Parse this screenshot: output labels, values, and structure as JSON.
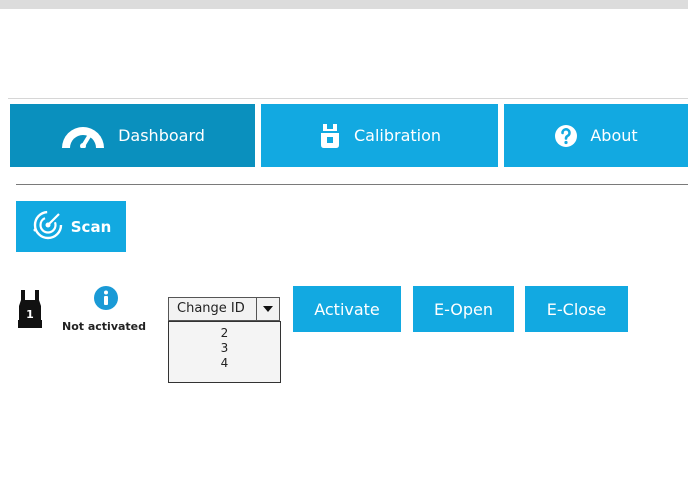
{
  "tabs": [
    {
      "label": "Dashboard",
      "icon": "dashboard-gauge-icon",
      "active": true
    },
    {
      "label": "Calibration",
      "icon": "gripper-calibration-icon",
      "active": false
    },
    {
      "label": "About",
      "icon": "question-icon",
      "active": false
    }
  ],
  "scan": {
    "label": "Scan",
    "icon": "radar-scan-icon"
  },
  "gripper": {
    "icon": "gripper-1-icon",
    "status_icon": "info-icon",
    "status": "Not activated"
  },
  "id_select": {
    "value": "Change ID",
    "options": [
      "2",
      "3",
      "4"
    ]
  },
  "actions": {
    "activate": "Activate",
    "e_open": "E-Open",
    "e_close": "E-Close"
  },
  "colors": {
    "primary": "#12a9e1",
    "active_tab": "#0a90be"
  }
}
